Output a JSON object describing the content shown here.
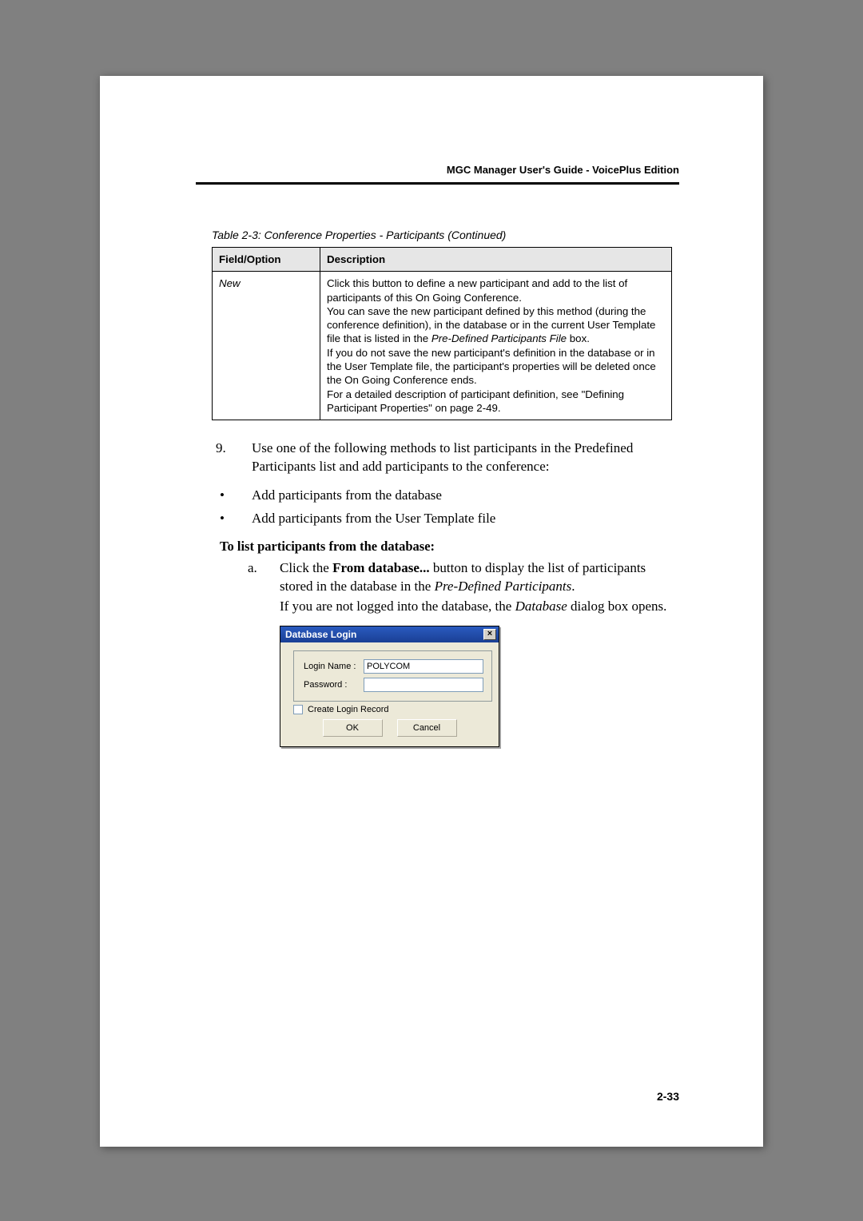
{
  "header": {
    "title": "MGC Manager User's Guide - VoicePlus Edition"
  },
  "table": {
    "caption": "Table 2-3: Conference Properties - Participants (Continued)",
    "head": {
      "c1": "Field/Option",
      "c2": "Description"
    },
    "row": {
      "field": "New",
      "p1": "Click this button to define a new participant and add to the list of participants of this On Going Conference.",
      "p2a": "You can save the new participant defined by this method (during the conference definition), in the database or in the current User Template file that is listed in the ",
      "p2i": "Pre-Defined Participants File",
      "p2b": " box.",
      "p3": "If you do not save the new participant's definition in the database or in the User Template file, the participant's properties will be deleted once the On Going Conference ends.",
      "p4": "For a detailed description of participant definition, see \"Defining Participant Properties\" on page 2-49."
    }
  },
  "step9": {
    "num": "9.",
    "text": "Use one of the following methods to list participants in the Predefined Participants list and add participants to the conference:"
  },
  "bullets": {
    "b1": "Add participants from the database",
    "b2": "Add participants from the User Template file"
  },
  "subhead": "To list participants from the database:",
  "stepA": {
    "al": "a.",
    "s1a": "Click the ",
    "s1b": "From database...",
    "s1c": " button to display the list of participants stored in the database in the ",
    "s1i": "Pre-Defined Participants",
    "s1d": ".",
    "s2a": "If you are not logged into the database, the ",
    "s2i": "Database",
    "s2b": " dialog box opens."
  },
  "dialog": {
    "title": "Database Login",
    "login_label": "Login Name :",
    "login_value": "POLYCOM",
    "pass_label": "Password :",
    "pass_value": "",
    "chk_label": "Create Login Record",
    "ok": "OK",
    "cancel": "Cancel"
  },
  "pagenum": "2-33"
}
